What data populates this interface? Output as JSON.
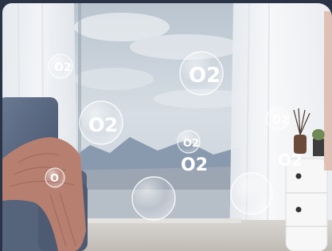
{
  "image": {
    "subject": "living-room-window-with-oxygen-bubbles"
  },
  "bubbles": [
    {
      "id": 1,
      "label": "O2",
      "style": "ring-bubble"
    },
    {
      "id": 2,
      "label": "O2",
      "style": "ring-bubble"
    },
    {
      "id": 3,
      "label": "O2",
      "style": "ring-bubble"
    },
    {
      "id": 4,
      "label": "O2",
      "style": "ring-bubble"
    },
    {
      "id": 5,
      "label": "O2",
      "style": "ring-bubble"
    },
    {
      "id": 6,
      "label": "O2",
      "style": "plain"
    },
    {
      "id": 7,
      "label": "O2",
      "style": "plain"
    },
    {
      "id": 8,
      "label": "O",
      "style": "ring-bubble"
    },
    {
      "id": 9,
      "label": "",
      "style": "empty-bubble"
    },
    {
      "id": 10,
      "label": "",
      "style": "empty-bubble"
    }
  ],
  "colors": {
    "outer-border": "#2b3446",
    "sky": "#cdd6de",
    "mountains": "#8a9aae",
    "sofa": "#5e6d84",
    "blanket": "#b67f70",
    "curtain": "#f4f4f6",
    "cabinet": "#f7f7f7"
  }
}
